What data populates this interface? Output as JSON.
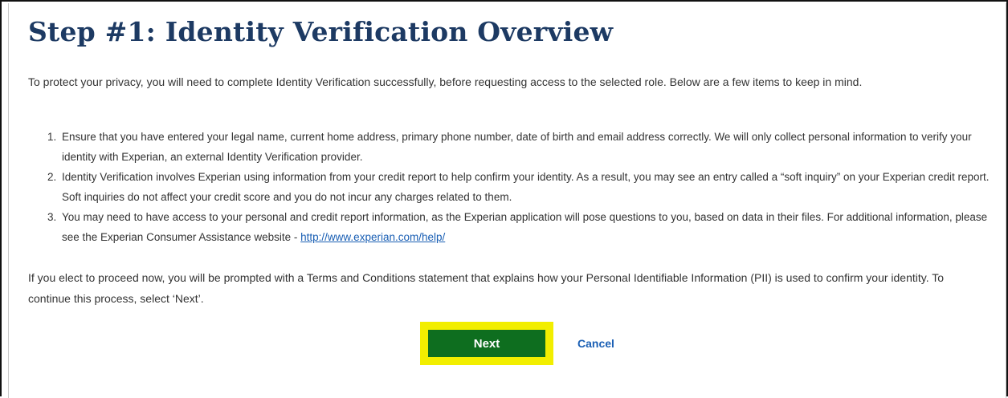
{
  "page": {
    "title": "Step #1: Identity Verification Overview",
    "intro": "To protect your privacy, you will need to complete Identity Verification successfully, before requesting access to the selected role. Below are a few items to keep in mind.",
    "steps": [
      {
        "number": "1.",
        "text": "Ensure that you have entered your legal name, current home address, primary phone number, date of birth and email address correctly. We will only collect personal information to verify your identity with Experian, an external Identity Verification provider."
      },
      {
        "number": "2.",
        "text": "Identity Verification involves Experian using information from your credit report to help confirm your identity. As a result, you may see an entry called a “soft inquiry” on your Experian credit report. Soft inquiries do not affect your credit score and you do not incur any charges related to them."
      },
      {
        "number": "3.",
        "text": "You may need to have access to your personal and credit report information, as the Experian application will pose questions to you, based on data in their files. For additional information, please see the Experian Consumer Assistance website - ",
        "link_text": "http://www.experian.com/help/"
      }
    ],
    "outro": "If you elect to proceed now, you will be prompted with a Terms and Conditions statement that explains how your Personal Identifiable Information (PII) is used to confirm your identity. To continue this process, select ‘Next’."
  },
  "actions": {
    "next_label": "Next",
    "cancel_label": "Cancel"
  },
  "colors": {
    "title": "#1d3a63",
    "next_button": "#0e6e1f",
    "highlight": "#f2ee00",
    "link": "#1a5fb4"
  }
}
